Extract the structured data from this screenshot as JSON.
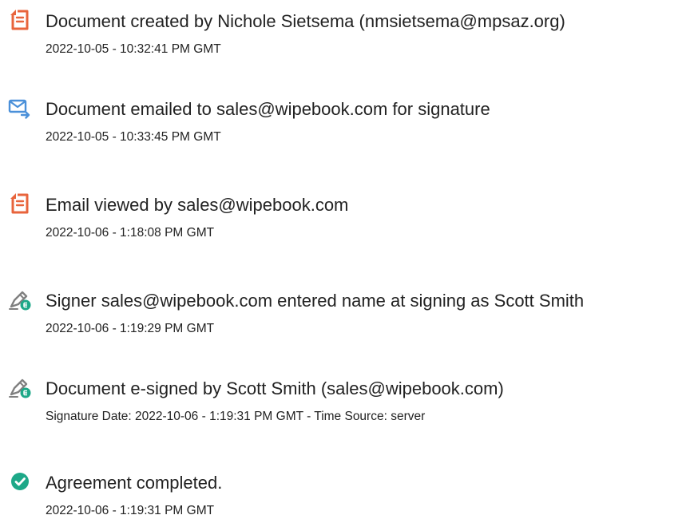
{
  "events": [
    {
      "icon": "document-created-icon",
      "title": "Document created by Nichole Sietsema (nmsietsema@mpsaz.org)",
      "time": "2022-10-05 - 10:32:41 PM GMT"
    },
    {
      "icon": "email-sent-icon",
      "title": "Document emailed to sales@wipebook.com for signature",
      "time": "2022-10-05 - 10:33:45 PM GMT"
    },
    {
      "icon": "document-viewed-icon",
      "title": "Email viewed by sales@wipebook.com",
      "time": "2022-10-06 - 1:18:08 PM GMT"
    },
    {
      "icon": "signer-pen-icon",
      "title": "Signer sales@wipebook.com entered name at signing as Scott Smith",
      "time": "2022-10-06 - 1:19:29 PM GMT"
    },
    {
      "icon": "e-signed-pen-icon",
      "title": "Document e-signed by Scott Smith (sales@wipebook.com)",
      "time": "Signature Date: 2022-10-06 - 1:19:31 PM GMT - Time Source: server"
    },
    {
      "icon": "completed-check-icon",
      "title": "Agreement completed.",
      "time": "2022-10-06 - 1:19:31 PM GMT"
    }
  ],
  "colors": {
    "orange": "#E8643C",
    "blue": "#4A90D9",
    "green": "#1DA888",
    "pen_gray": "#808080"
  }
}
